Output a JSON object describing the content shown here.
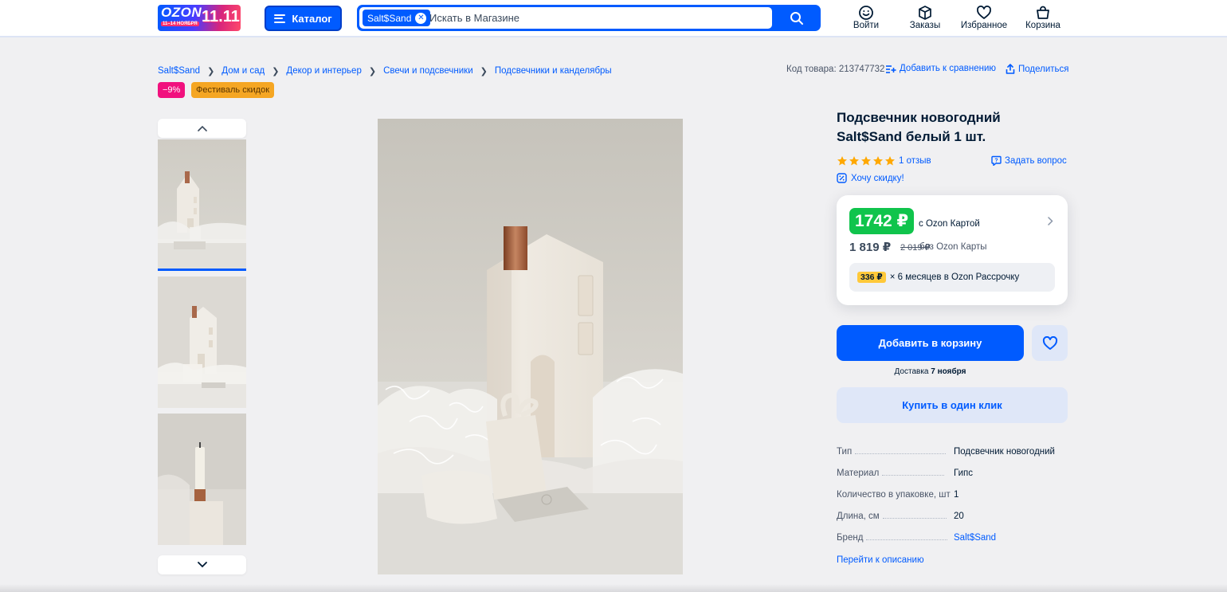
{
  "header": {
    "logo": {
      "brand": "OZON",
      "promo_dates": "11–14 НОЯБРЯ",
      "promo": "11.11"
    },
    "catalog_label": "Каталог",
    "search": {
      "chip": "Salt$Sand",
      "placeholder": "Искать в Магазине"
    },
    "nav": [
      {
        "label": "Войти",
        "icon": "smile-icon"
      },
      {
        "label": "Заказы",
        "icon": "box-icon"
      },
      {
        "label": "Избранное",
        "icon": "heart-icon"
      },
      {
        "label": "Корзина",
        "icon": "bag-icon"
      }
    ]
  },
  "breadcrumbs": [
    "Salt$Sand",
    "Дом и сад",
    "Декор и интерьер",
    "Свечи и подсвечники",
    "Подсвечники и канделябры"
  ],
  "product_code": "Код товара: 213747732",
  "compare_label": "Добавить к сравнению",
  "share_label": "Поделиться",
  "badges": {
    "discount": "−9%",
    "festival": "Фестиваль скидок"
  },
  "product": {
    "title": "Подсвечник новогодний Salt$Sand белый 1 шт.",
    "rating": 5,
    "reviews": "1 отзыв",
    "ask_label": "Задать вопрос",
    "want_discount": "Хочу скидку!"
  },
  "price": {
    "card_price": "1742 ₽",
    "card_caption": "с Ozon Картой",
    "regular_price": "1 819 ₽",
    "old_price": "2 019 ₽",
    "regular_caption": "без Ozon Карты",
    "installment_amount": "336 ₽",
    "installment_text": "× 6 месяцев в Ozon Рассрочку"
  },
  "actions": {
    "add_to_cart": "Добавить в корзину",
    "delivery_prefix": "Доставка ",
    "delivery_date": "7 ноября",
    "buy_one_click": "Купить в один клик"
  },
  "specs": [
    {
      "key": "Тип",
      "value": "Подсвечник новогодний"
    },
    {
      "key": "Материал",
      "value": "Гипс"
    },
    {
      "key": "Количество в упаковке, шт",
      "value": "1"
    },
    {
      "key": "Длина, см",
      "value": "20"
    },
    {
      "key": "Бренд",
      "value": "Salt$Sand"
    }
  ],
  "go_to_description": "Перейти к описанию",
  "colors": {
    "accent": "#005bff",
    "price_green": "#10c44c",
    "discount_red": "#f1117e",
    "festival_orange": "#f5a623"
  }
}
